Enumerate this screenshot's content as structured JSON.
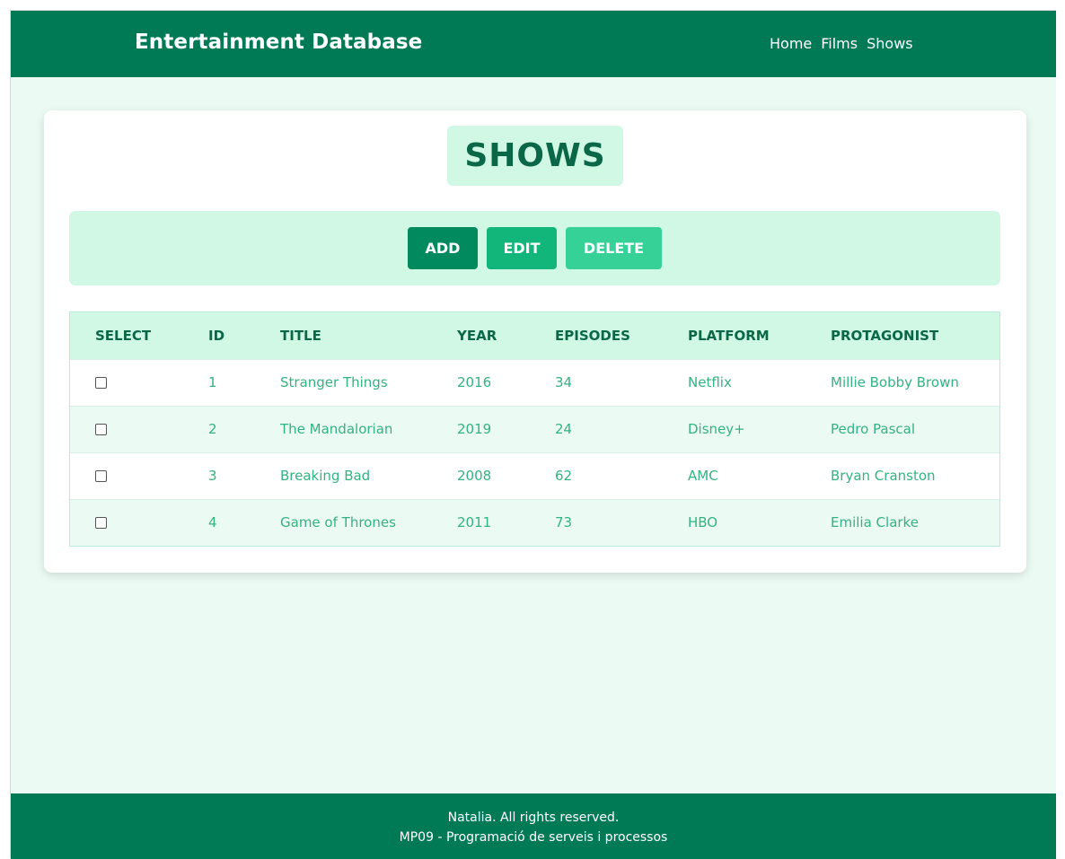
{
  "header": {
    "brand": "Entertainment Database",
    "nav": [
      "Home",
      "Films",
      "Shows"
    ]
  },
  "page": {
    "title": "SHOWS"
  },
  "toolbar": {
    "add_label": "ADD",
    "edit_label": "EDIT",
    "delete_label": "DELETE"
  },
  "table": {
    "columns": [
      "SELECT",
      "ID",
      "TITLE",
      "YEAR",
      "EPISODES",
      "PLATFORM",
      "PROTAGONIST"
    ],
    "rows": [
      {
        "id": "1",
        "title": "Stranger Things",
        "year": "2016",
        "episodes": "34",
        "platform": "Netflix",
        "protagonist": "Millie Bobby Brown",
        "selected": false
      },
      {
        "id": "2",
        "title": "The Mandalorian",
        "year": "2019",
        "episodes": "24",
        "platform": "Disney+",
        "protagonist": "Pedro Pascal",
        "selected": false
      },
      {
        "id": "3",
        "title": "Breaking Bad",
        "year": "2008",
        "episodes": "62",
        "platform": "AMC",
        "protagonist": "Bryan Cranston",
        "selected": false
      },
      {
        "id": "4",
        "title": "Game of Thrones",
        "year": "2011",
        "episodes": "73",
        "platform": "HBO",
        "protagonist": "Emilia Clarke",
        "selected": false
      }
    ]
  },
  "footer": {
    "line1": "Natalia. All rights reserved.",
    "line2": "MP09 - Programació de serveis i processos"
  },
  "colors": {
    "primary": "#007a55",
    "accent_light": "#d0f8e5",
    "background": "#ecfaf4",
    "text_green": "#33b381"
  }
}
